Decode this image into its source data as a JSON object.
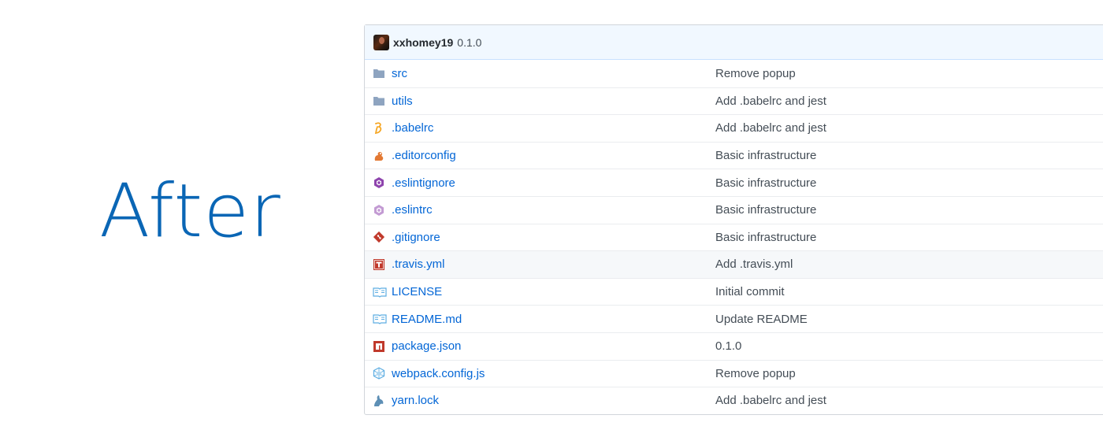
{
  "heading": "After",
  "commit": {
    "user": "xxhomey19",
    "message": "0.1.0"
  },
  "files": [
    {
      "name": "src",
      "message": "Remove popup",
      "icon": "folder-icon",
      "color": "#79b8ff"
    },
    {
      "name": "utils",
      "message": "Add .babelrc and jest",
      "icon": "folder-icon",
      "color": "#79b8ff"
    },
    {
      "name": ".babelrc",
      "message": "Add .babelrc and jest",
      "icon": "babel-icon",
      "color": "#f5a623"
    },
    {
      "name": ".editorconfig",
      "message": "Basic infrastructure",
      "icon": "editorconfig-icon",
      "color": "#e37933"
    },
    {
      "name": ".eslintignore",
      "message": "Basic infrastructure",
      "icon": "eslint-icon",
      "color": "#8e44ad"
    },
    {
      "name": ".eslintrc",
      "message": "Basic infrastructure",
      "icon": "eslint-icon",
      "color": "#c39bd3"
    },
    {
      "name": ".gitignore",
      "message": "Basic infrastructure",
      "icon": "git-icon",
      "color": "#c0392b"
    },
    {
      "name": ".travis.yml",
      "message": "Add .travis.yml",
      "icon": "travis-icon",
      "color": "#c0392b"
    },
    {
      "name": "LICENSE",
      "message": "Initial commit",
      "icon": "book-icon",
      "color": "#5dade2"
    },
    {
      "name": "README.md",
      "message": "Update README",
      "icon": "book-icon",
      "color": "#5dade2"
    },
    {
      "name": "package.json",
      "message": "0.1.0",
      "icon": "npm-icon",
      "color": "#c0392b"
    },
    {
      "name": "webpack.config.js",
      "message": "Remove popup",
      "icon": "webpack-icon",
      "color": "#5dade2"
    },
    {
      "name": "yarn.lock",
      "message": "Add .babelrc and jest",
      "icon": "yarn-icon",
      "color": "#5d8fb5"
    }
  ]
}
